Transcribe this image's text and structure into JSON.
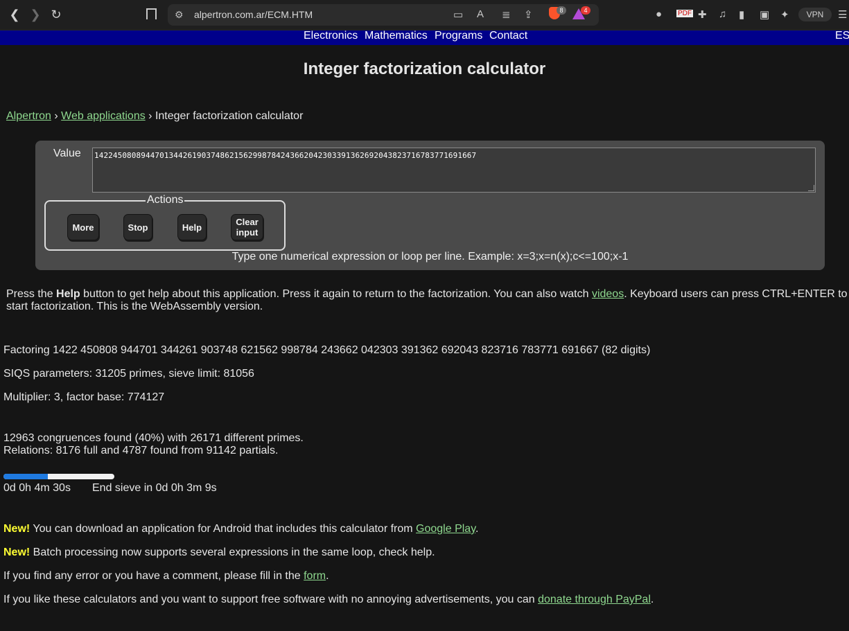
{
  "browser": {
    "url": "alpertron.com.ar/ECM.HTM",
    "shield_badge": "8",
    "alert_badge": "4",
    "vpn_label": "VPN"
  },
  "sitenav": {
    "links": [
      "Electronics",
      "Mathematics",
      "Programs",
      "Contact"
    ],
    "lang": "ES"
  },
  "page": {
    "title": "Integer factorization calculator",
    "breadcrumb": {
      "home": "Alpertron",
      "sep": "›",
      "section": "Web applications",
      "current": "Integer factorization calculator"
    }
  },
  "calculator": {
    "value_label": "Value",
    "value": "1422450808944701344261903748621562998784243662042303391362692043823716783771691667",
    "actions_legend": "Actions",
    "buttons": {
      "more": "More",
      "stop": "Stop",
      "help": "Help",
      "clear_line1": "Clear",
      "clear_line2": "input"
    },
    "hint": "Type one numerical expression or loop per line. Example: x=3;x=n(x);c<=100;x-1"
  },
  "help_text": {
    "part1": "Press the ",
    "help_word": "Help",
    "part2": " button to get help about this application. Press it again to return to the factorization. You can also watch ",
    "videos_link": "videos",
    "part3": ". Keyboard users can press CTRL+ENTER to start factorization. This is the WebAssembly version."
  },
  "status": {
    "factoring": "Factoring 1422 450808 944701 344261 903748 621562 998784 243662 042303 391362 692043 823716 783771 691667 (82 digits)",
    "siqs": "SIQS parameters: 31205 primes, sieve limit: 81056",
    "multiplier": "Multiplier: 3, factor base: 774127",
    "congruences": "12963 congruences found (40%) with 26171 different primes.",
    "relations": "Relations: 8176 full and 4787 found from 91142 partials.",
    "progress_fraction": 0.4,
    "elapsed": "0d 0h 4m 30s",
    "end_sieve": "End sieve in 0d 0h 3m 9s"
  },
  "news": {
    "new_tag": "New!",
    "android_text": " You can download an application for Android that includes this calculator from ",
    "google_play": "Google Play",
    "period": ".",
    "batch_text": " Batch processing now supports several expressions in the same loop, check help.",
    "error_text": "If you find any error or you have a comment, please fill in the ",
    "form_link": "form",
    "support_text": "If you like these calculators and you want to support free software with no annoying advertisements, you can ",
    "paypal_link": "donate through PayPal"
  },
  "colors": {
    "background": "#151515",
    "link": "#8fd98f",
    "nav_bar": "#00008b",
    "new_tag": "#ffff33",
    "progress": "#1f7ae0",
    "panel": "#4a4a4a"
  }
}
